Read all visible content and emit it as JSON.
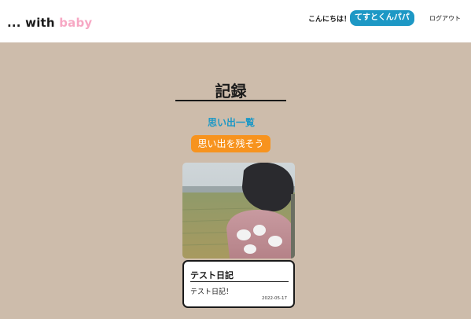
{
  "header": {
    "logo": {
      "dots": "...",
      "with": "with",
      "baby": "baby"
    },
    "greeting": "こんにちは！",
    "user_name": "てすとくんパパ",
    "logout": "ログアウト"
  },
  "main": {
    "title": "記録",
    "list_link": "思い出一覧",
    "create_button": "思い出を残そう"
  },
  "diary": {
    "title": "テスト日記",
    "body": "テスト日記！",
    "date": "2022-05-17"
  },
  "colors": {
    "background": "#cdbcab",
    "accent_blue": "#1d98c5",
    "accent_orange": "#f7931e",
    "logo_pink": "#f7a8c4"
  }
}
